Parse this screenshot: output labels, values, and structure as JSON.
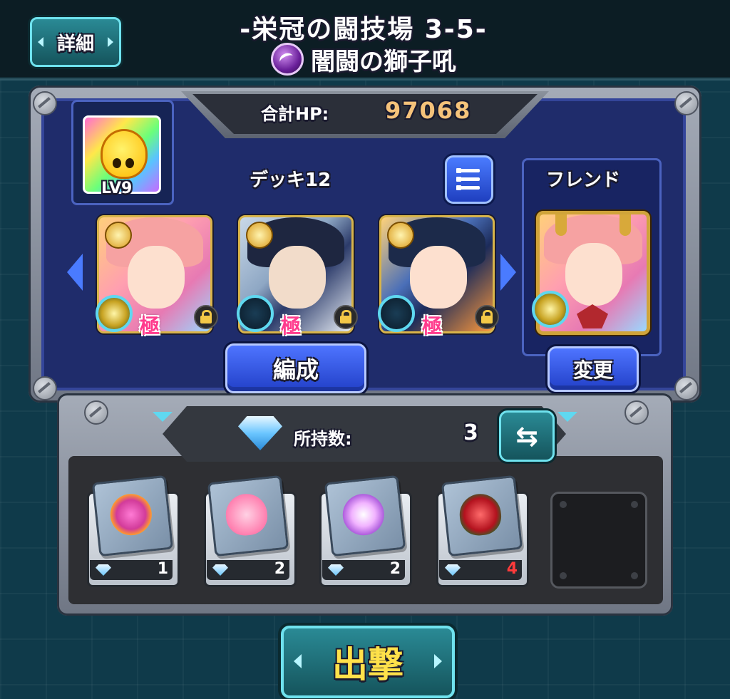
{
  "header": {
    "detail_button": "詳細",
    "stage_title": "-栄冠の闘技場 3-5-",
    "stage_subtitle": "闇闘の獅子吼",
    "element_icon": "dark-element-icon"
  },
  "team": {
    "total_hp_label": "合計HP:",
    "total_hp_value": "97068",
    "player_level": "LV9",
    "deck_label": "デッキ12",
    "list_icon": "list-icon",
    "friend_label": "フレンド",
    "monster_badge": "極",
    "formation_button": "編成",
    "change_button": "変更"
  },
  "items": {
    "gem_label": "所持数:",
    "gem_count": "3",
    "swap_icon": "⇆",
    "slots": [
      {
        "icon": "speed-up-item-icon",
        "qty": "1",
        "qty_color": "#ffffff"
      },
      {
        "icon": "heal-heart-item-icon",
        "qty": "2",
        "qty_color": "#ffffff"
      },
      {
        "icon": "power-orb-item-icon",
        "qty": "2",
        "qty_color": "#ffffff"
      },
      {
        "icon": "rose-item-icon",
        "qty": "4",
        "qty_color": "#ff3b3b"
      }
    ]
  },
  "sortie_button": "出撃",
  "colors": {
    "accent_cyan": "#6fe2ee",
    "hp_value": "#f5c27a",
    "button_blue": "#2240c8",
    "panel_navy": "#1f2c6b"
  }
}
